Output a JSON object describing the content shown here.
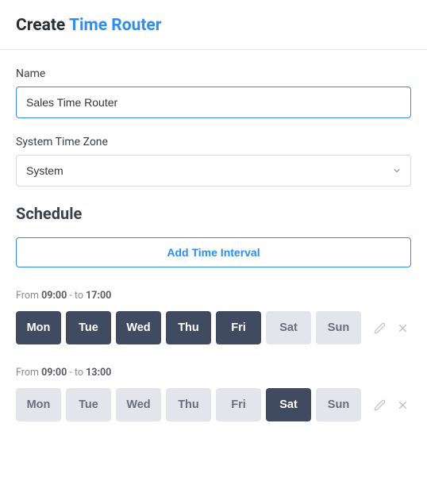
{
  "header": {
    "prefix": "Create ",
    "accent": "Time Router"
  },
  "fields": {
    "name_label": "Name",
    "name_value": "Sales Time Router",
    "tz_label": "System Time Zone",
    "tz_value": "System"
  },
  "schedule": {
    "title": "Schedule",
    "add_label": "Add Time Interval",
    "label_from": "From ",
    "label_to": " - to ",
    "days": [
      "Mon",
      "Tue",
      "Wed",
      "Thu",
      "Fri",
      "Sat",
      "Sun"
    ],
    "intervals": [
      {
        "from": "09:00",
        "to": "17:00",
        "active": [
          true,
          true,
          true,
          true,
          true,
          false,
          false
        ]
      },
      {
        "from": "09:00",
        "to": "13:00",
        "active": [
          false,
          false,
          false,
          false,
          false,
          true,
          false
        ]
      }
    ]
  }
}
